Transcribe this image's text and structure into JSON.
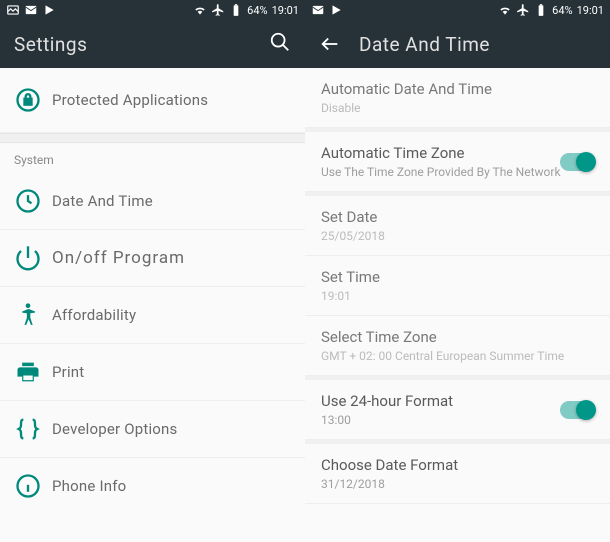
{
  "status": {
    "battery": "64%",
    "time": "19:01"
  },
  "left": {
    "title": "Settings",
    "protected": "Protected Applications",
    "system_label": "System",
    "items": {
      "date_time": "Date And Time",
      "on_off": "On/off Program",
      "affordability": "Affordability",
      "print": "Print",
      "developer": "Developer Options",
      "phone_info": "Phone Info"
    }
  },
  "right": {
    "title": "Date And Time",
    "auto_date": {
      "title": "Automatic Date And Time",
      "value": "Disable"
    },
    "auto_tz": {
      "title": "Automatic Time Zone",
      "value": "Use The Time Zone Provided By The Network"
    },
    "set_date": {
      "title": "Set Date",
      "value": "25/05/2018"
    },
    "set_time": {
      "title": "Set Time",
      "value": "19:01"
    },
    "select_tz": {
      "title": "Select Time Zone",
      "value": "GMT + 02: 00 Central European Summer Time"
    },
    "hour24": {
      "title": "Use 24-hour Format",
      "value": "13:00"
    },
    "date_format": {
      "title": "Choose Date Format",
      "value": "31/12/2018"
    }
  }
}
